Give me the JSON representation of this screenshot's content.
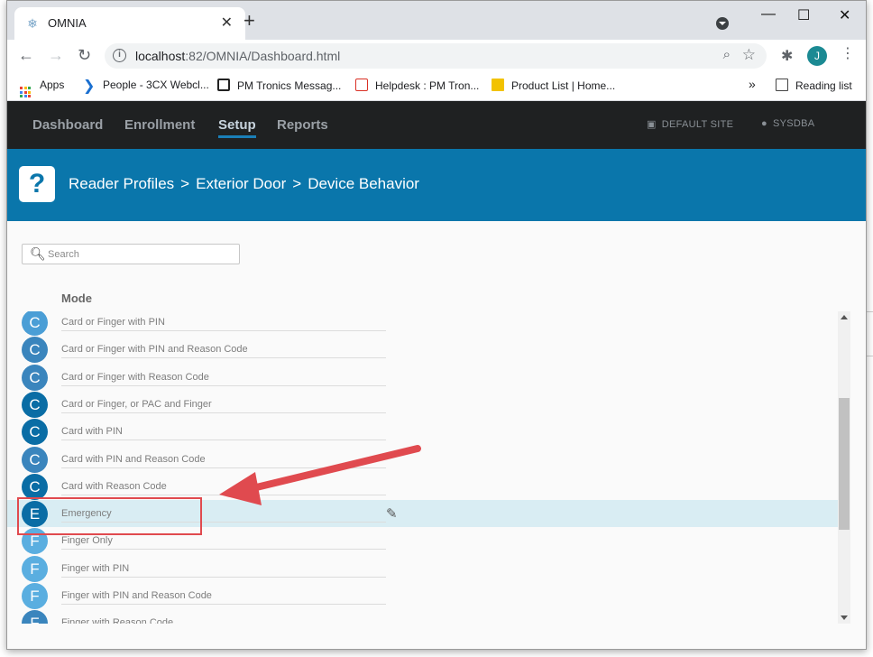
{
  "browser": {
    "tab_title": "OMNIA",
    "tab_close": "✕",
    "new_tab": "+",
    "url_host": "localhost",
    "url_rest": ":82/OMNIA/Dashboard.html",
    "profile_initial": "J",
    "window_controls": {
      "minimize": "—",
      "maximize": "☐",
      "close": "✕"
    }
  },
  "bookmarks": [
    {
      "label": "Apps",
      "icon": "apps-grid-icon"
    },
    {
      "label": "People - 3CX Webcl...",
      "icon": "3cx-icon",
      "color": "#1a6fd0"
    },
    {
      "label": "PM Tronics Messag...",
      "icon": "pm-tronics-icon"
    },
    {
      "label": "Helpdesk : PM Tron...",
      "icon": "helpdesk-icon",
      "color": "#d93025"
    },
    {
      "label": "Product List | Home...",
      "icon": "note-icon",
      "color": "#f2c200"
    }
  ],
  "bookmarks_overflow": "»",
  "reading_list": "Reading list",
  "app_nav": {
    "links": [
      {
        "label": "Dashboard",
        "active": false
      },
      {
        "label": "Enrollment",
        "active": false
      },
      {
        "label": "Setup",
        "active": true
      },
      {
        "label": "Reports",
        "active": false
      }
    ],
    "site": "DEFAULT SITE",
    "user": "SYSDBA"
  },
  "banner": {
    "help_glyph": "?",
    "crumbs": [
      "Reader Profiles",
      "Exterior Door",
      "Device Behavior"
    ],
    "separator": ">"
  },
  "search": {
    "placeholder": "Search"
  },
  "table": {
    "column": "Mode",
    "rows": [
      {
        "initial": "C",
        "label": "Card or Finger with PIN",
        "color": "#4a9ed6"
      },
      {
        "initial": "C",
        "label": "Card or Finger with PIN and Reason Code",
        "color": "#3a85bd"
      },
      {
        "initial": "C",
        "label": "Card or Finger with Reason Code",
        "color": "#3a85bd"
      },
      {
        "initial": "C",
        "label": "Card or Finger, or PAC and Finger",
        "color": "#0a6da5"
      },
      {
        "initial": "C",
        "label": "Card with PIN",
        "color": "#0a6da5"
      },
      {
        "initial": "C",
        "label": "Card with PIN and Reason Code",
        "color": "#3a85bd"
      },
      {
        "initial": "C",
        "label": "Card with Reason Code",
        "color": "#0a6da5"
      },
      {
        "initial": "E",
        "label": "Emergency",
        "color": "#0a6da5",
        "selected": true
      },
      {
        "initial": "F",
        "label": "Finger Only",
        "color": "#5aaee0"
      },
      {
        "initial": "F",
        "label": "Finger with PIN",
        "color": "#5aaee0"
      },
      {
        "initial": "F",
        "label": "Finger with PIN and Reason Code",
        "color": "#5aaee0"
      },
      {
        "initial": "F",
        "label": "Finger with Reason Code",
        "color": "#3a85bd"
      }
    ]
  },
  "colors": {
    "nav_bg": "#1f2122",
    "banner_bg": "#0a76ab",
    "selected_row": "#d9edf3",
    "annotation": "#e04a4f"
  }
}
